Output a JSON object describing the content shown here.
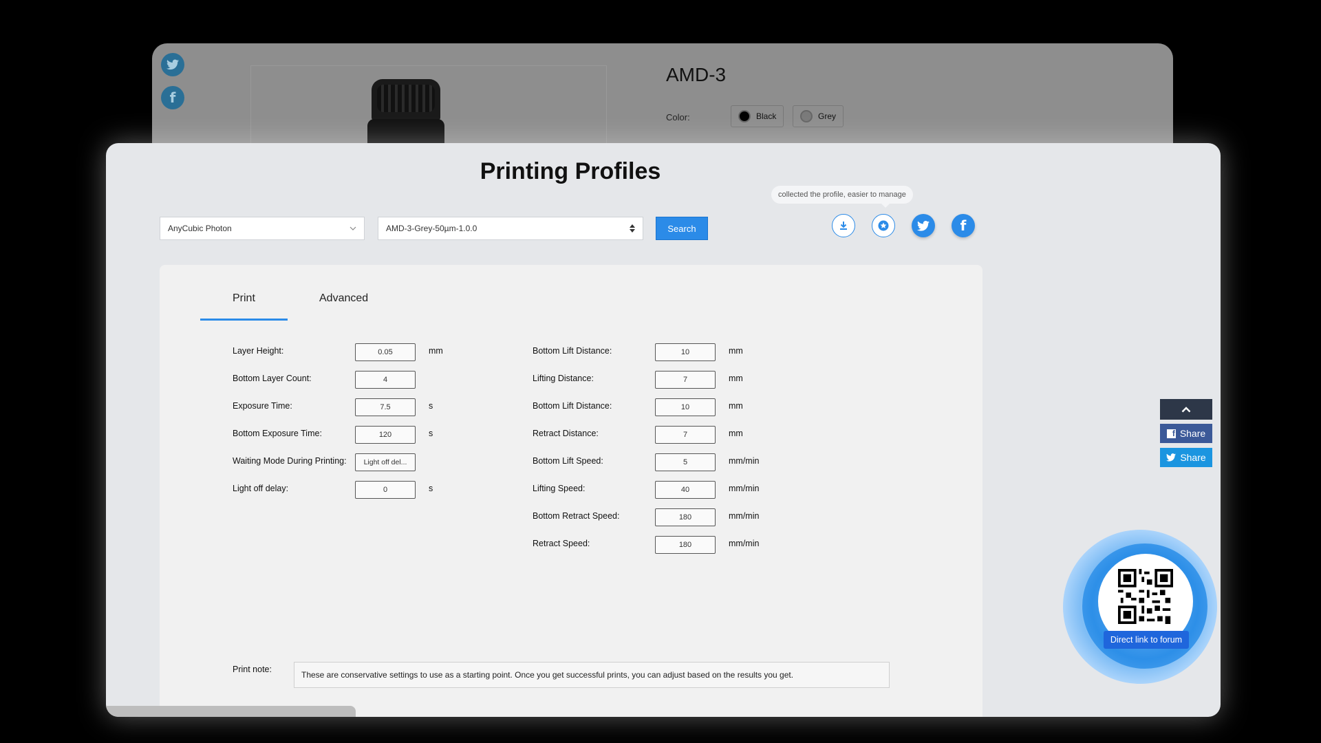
{
  "background_page": {
    "product_title": "AMD-3",
    "color_label": "Color:",
    "colors": [
      {
        "label": "Black",
        "swatch": "#000000"
      },
      {
        "label": "Grey",
        "swatch": "#7a7a7a"
      }
    ]
  },
  "modal": {
    "title": "Printing Profiles",
    "printer_select": "AnyCubic Photon",
    "profile_select": "AMD-3-Grey-50µm-1.0.0",
    "search_label": "Search",
    "tooltip": "collected the profile, easier to manage"
  },
  "tabs": [
    {
      "label": "Print",
      "active": true
    },
    {
      "label": "Advanced",
      "active": false
    }
  ],
  "print_fields_left": [
    {
      "label": "Layer Height:",
      "value": "0.05",
      "unit": "mm"
    },
    {
      "label": "Bottom Layer Count:",
      "value": "4",
      "unit": ""
    },
    {
      "label": "Exposure Time:",
      "value": "7.5",
      "unit": "s"
    },
    {
      "label": "Bottom Exposure Time:",
      "value": "120",
      "unit": "s"
    },
    {
      "label": "Waiting Mode During Printing:",
      "value": "Light off del...",
      "unit": ""
    },
    {
      "label": "Light off delay:",
      "value": "0",
      "unit": "s"
    }
  ],
  "print_fields_right": [
    {
      "label": "Bottom Lift Distance:",
      "value": "10",
      "unit": "mm"
    },
    {
      "label": "Lifting Distance:",
      "value": "7",
      "unit": "mm"
    },
    {
      "label": "Bottom Lift Distance:",
      "value": "10",
      "unit": "mm"
    },
    {
      "label": "Retract Distance:",
      "value": "7",
      "unit": "mm"
    },
    {
      "label": "Bottom Lift Speed:",
      "value": "5",
      "unit": "mm/min"
    },
    {
      "label": "Lifting Speed:",
      "value": "40",
      "unit": "mm/min"
    },
    {
      "label": "Bottom Retract Speed:",
      "value": "180",
      "unit": "mm/min"
    },
    {
      "label": "Retract Speed:",
      "value": "180",
      "unit": "mm/min"
    }
  ],
  "note": {
    "label": "Print note:",
    "text": "These are conservative settings to use as a starting point. Once you get successful prints, you can adjust based on the results you get."
  },
  "floating_share": {
    "facebook_label": "Share",
    "twitter_label": "Share",
    "facebook_color": "#3b5998",
    "twitter_color": "#1b95e0"
  },
  "qr_widget": {
    "label": "Direct link to forum"
  },
  "colors": {
    "accent": "#2b8be8",
    "modal_bg": "#e5e7ea"
  }
}
